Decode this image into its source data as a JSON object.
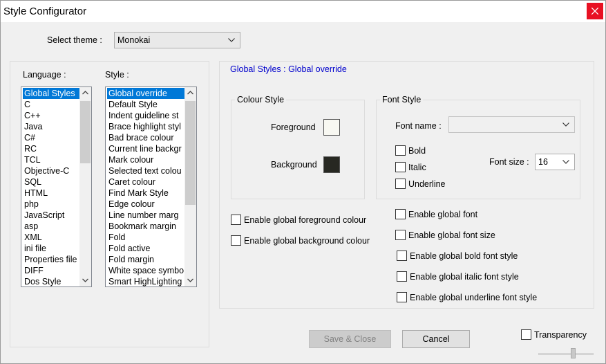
{
  "window": {
    "title": "Style Configurator",
    "close_icon": "close-icon"
  },
  "theme": {
    "label": "Select theme :",
    "value": "Monokai"
  },
  "language": {
    "label": "Language :",
    "items": [
      "Global Styles",
      "C",
      "C++",
      "Java",
      "C#",
      "RC",
      "TCL",
      "Objective-C",
      "SQL",
      "HTML",
      "php",
      "JavaScript",
      "asp",
      "XML",
      "ini file",
      "Properties file",
      "DIFF",
      "Dos Style"
    ],
    "selected": "Global Styles"
  },
  "style": {
    "label": "Style :",
    "items": [
      "Global override",
      "Default Style",
      "Indent guideline st",
      "Brace highlight styl",
      "Bad brace colour",
      "Current line backgr",
      "Mark colour",
      "Selected text colou",
      "Caret colour",
      "Find Mark Style",
      "Edge colour",
      "Line number marg",
      "Bookmark margin",
      "Fold",
      "Fold active",
      "Fold margin",
      "White space symbo",
      "Smart HighLighting"
    ],
    "selected": "Global override"
  },
  "detail": {
    "heading": "Global Styles : Global override",
    "colour_style": {
      "legend": "Colour Style",
      "foreground_label": "Foreground",
      "background_label": "Background",
      "foreground_color": "#f8f8f2",
      "background_color": "#272822"
    },
    "font_style": {
      "legend": "Font Style",
      "font_name_label": "Font name :",
      "font_name_value": "",
      "font_size_label": "Font size :",
      "font_size_value": "16",
      "bold": "Bold",
      "italic": "Italic",
      "underline": "Underline"
    },
    "enable_fg": "Enable global foreground colour",
    "enable_bg": "Enable global background colour",
    "enable_font": "Enable global font",
    "enable_font_size": "Enable global font size",
    "enable_bold": "Enable global bold font style",
    "enable_italic": "Enable global italic font style",
    "enable_underline": "Enable global underline font style"
  },
  "buttons": {
    "save_close": "Save & Close",
    "cancel": "Cancel"
  },
  "transparency": {
    "label": "Transparency",
    "slider_level": 0.65
  },
  "colors": {
    "heading_blue": "#0000cc",
    "selection_blue": "#0078d7",
    "close_red": "#e81123"
  }
}
